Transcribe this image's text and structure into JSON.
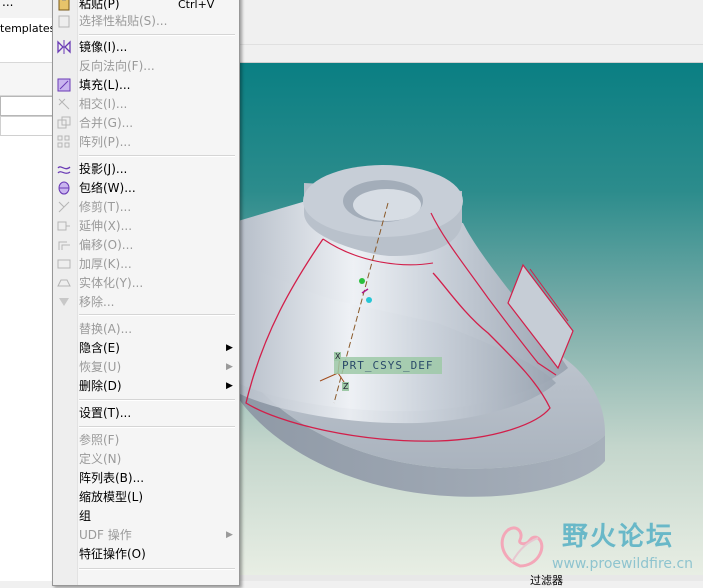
{
  "left_panel": {
    "dots": "...",
    "path": "templates\\"
  },
  "menu": {
    "items": [
      {
        "label": "粘贴(P)",
        "shortcut": "Ctrl+V",
        "disabled": false,
        "icon": "paste-icon"
      },
      {
        "label": "选择性粘贴(S)...",
        "disabled": true,
        "icon": "paste-special-icon"
      },
      {
        "label": "镜像(I)...",
        "disabled": false,
        "icon": "mirror-icon"
      },
      {
        "label": "反向法向(F)...",
        "disabled": true,
        "icon": ""
      },
      {
        "label": "填充(L)...",
        "disabled": false,
        "icon": "fill-icon"
      },
      {
        "label": "相交(I)...",
        "disabled": true,
        "icon": "intersect-icon"
      },
      {
        "label": "合并(G)...",
        "disabled": true,
        "icon": "merge-icon"
      },
      {
        "label": "阵列(P)...",
        "disabled": true,
        "icon": "pattern-icon"
      },
      {
        "label": "投影(J)...",
        "disabled": false,
        "icon": "project-icon"
      },
      {
        "label": "包络(W)...",
        "disabled": false,
        "icon": "wrap-icon"
      },
      {
        "label": "修剪(T)...",
        "disabled": true,
        "icon": "trim-icon"
      },
      {
        "label": "延伸(X)...",
        "disabled": true,
        "icon": "extend-icon"
      },
      {
        "label": "偏移(O)...",
        "disabled": true,
        "icon": "offset-icon"
      },
      {
        "label": "加厚(K)...",
        "disabled": true,
        "icon": "thicken-icon"
      },
      {
        "label": "实体化(Y)...",
        "disabled": true,
        "icon": "solidify-icon"
      },
      {
        "label": "移除...",
        "disabled": true,
        "icon": "remove-icon"
      },
      {
        "label": "替换(A)...",
        "disabled": true,
        "icon": ""
      },
      {
        "label": "隐含(E)",
        "disabled": false,
        "submenu": true
      },
      {
        "label": "恢复(U)",
        "disabled": true,
        "submenu": true
      },
      {
        "label": "删除(D)",
        "disabled": false,
        "submenu": true
      },
      {
        "label": "设置(T)...",
        "disabled": false
      },
      {
        "label": "参照(F)",
        "disabled": true
      },
      {
        "label": "定义(N)",
        "disabled": true
      },
      {
        "label": "阵列表(B)...",
        "disabled": false
      },
      {
        "label": "缩放模型(L)",
        "disabled": false
      },
      {
        "label": "组",
        "disabled": false
      },
      {
        "label": "UDF 操作",
        "disabled": true,
        "submenu": true
      },
      {
        "label": "特征操作(O)",
        "disabled": false
      }
    ]
  },
  "viewport": {
    "csys_label": "PRT_CSYS_DEF",
    "axis_x": "X",
    "axis_z": "Z"
  },
  "watermark": {
    "title": "野火论坛",
    "url": "www.proewildfire.cn"
  },
  "status": {
    "text": "过滤器"
  },
  "colors": {
    "bg_top": "#0a7f83",
    "bg_bottom": "#e8eee4",
    "model": "#c2c9d2",
    "edge_highlight": "#d21f4a"
  }
}
